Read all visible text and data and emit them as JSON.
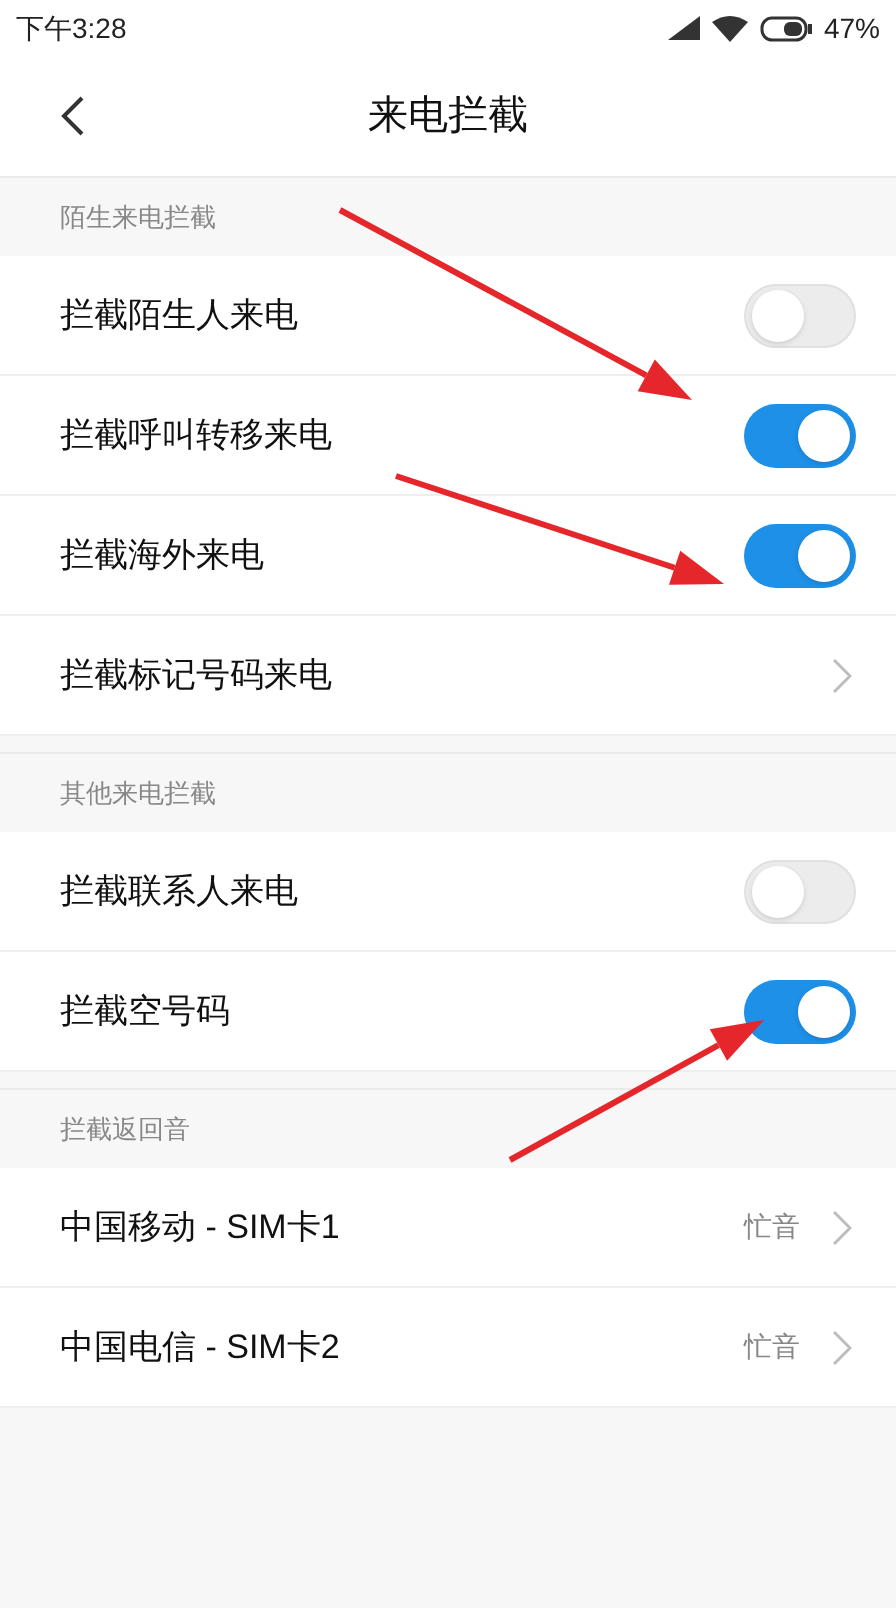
{
  "status_bar": {
    "time": "下午3:28",
    "battery": "47%"
  },
  "header": {
    "title": "来电拦截"
  },
  "sections": [
    {
      "title": "陌生来电拦截",
      "items": [
        {
          "kind": "toggle",
          "label": "拦截陌生人来电",
          "on": false
        },
        {
          "kind": "toggle",
          "label": "拦截呼叫转移来电",
          "on": true
        },
        {
          "kind": "toggle",
          "label": "拦截海外来电",
          "on": true
        },
        {
          "kind": "link",
          "label": "拦截标记号码来电"
        }
      ]
    },
    {
      "title": "其他来电拦截",
      "items": [
        {
          "kind": "toggle",
          "label": "拦截联系人来电",
          "on": false
        },
        {
          "kind": "toggle",
          "label": "拦截空号码",
          "on": true
        }
      ]
    },
    {
      "title": "拦截返回音",
      "items": [
        {
          "kind": "link",
          "label": "中国移动 - SIM卡1",
          "value": "忙音"
        },
        {
          "kind": "link",
          "label": "中国电信 - SIM卡2",
          "value": "忙音"
        }
      ]
    }
  ]
}
